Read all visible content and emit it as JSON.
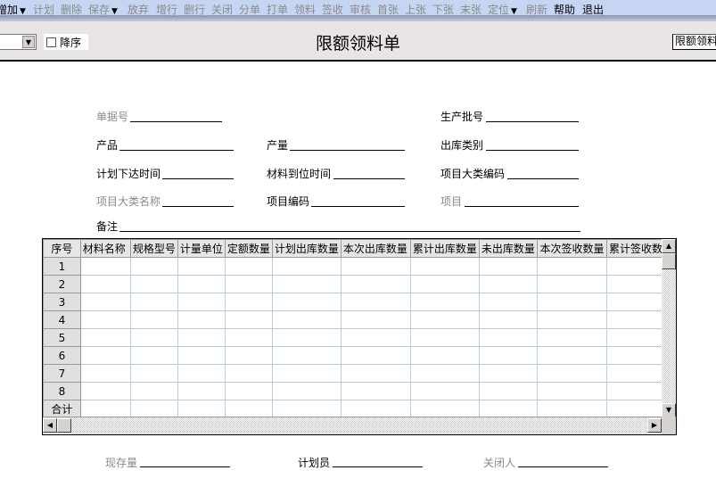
{
  "toolbar": {
    "items": [
      {
        "label": "增加",
        "enabled": true,
        "dropdown": true
      },
      {
        "label": "计划",
        "enabled": false
      },
      {
        "label": "删除",
        "enabled": false
      },
      {
        "label": "保存",
        "enabled": false,
        "dropdown": true
      },
      {
        "label": "放弃",
        "enabled": false
      },
      {
        "label": "增行",
        "enabled": false
      },
      {
        "label": "删行",
        "enabled": false
      },
      {
        "label": "关闭",
        "enabled": false
      },
      {
        "label": "分单",
        "enabled": false
      },
      {
        "label": "打单",
        "enabled": false
      },
      {
        "label": "领料",
        "enabled": false
      },
      {
        "label": "签收",
        "enabled": false
      },
      {
        "label": "审核",
        "enabled": false
      },
      {
        "label": "首张",
        "enabled": false
      },
      {
        "label": "上张",
        "enabled": false
      },
      {
        "label": "下张",
        "enabled": false
      },
      {
        "label": "末张",
        "enabled": false
      },
      {
        "label": "定位",
        "enabled": false,
        "dropdown": true
      },
      {
        "label": "刷新",
        "enabled": false
      },
      {
        "label": "帮助",
        "enabled": true
      },
      {
        "label": "退出",
        "enabled": true
      }
    ],
    "dropdown_glyph": "▼"
  },
  "header": {
    "title": "限额领料单",
    "sort_desc_label": "降序",
    "sort_desc_checked": false,
    "sort_field_value": "",
    "template_value": "限额领料单"
  },
  "form": {
    "doc_no": "单据号",
    "batch_no": "生产批号",
    "product": "产品",
    "quantity": "产量",
    "outbound_type": "出库类别",
    "plan_time": "计划下达时间",
    "material_time": "材料到位时间",
    "project_category_code": "项目大类编码",
    "project_category_name": "项目大类名称",
    "project_code": "项目编码",
    "project": "项目",
    "remark": "备注"
  },
  "grid": {
    "row_header": "序号",
    "columns": [
      "材料名称",
      "规格型号",
      "计量单位",
      "定额数量",
      "计划出库数量",
      "本次出库数量",
      "累计出库数量",
      "未出库数量",
      "本次签收数量",
      "累计签收数量"
    ],
    "rows": [
      "1",
      "2",
      "3",
      "4",
      "5",
      "6",
      "7",
      "8"
    ],
    "total_label": "合计"
  },
  "footer": {
    "stock": "现存量",
    "planner": "计划员",
    "closer": "关闭人"
  }
}
